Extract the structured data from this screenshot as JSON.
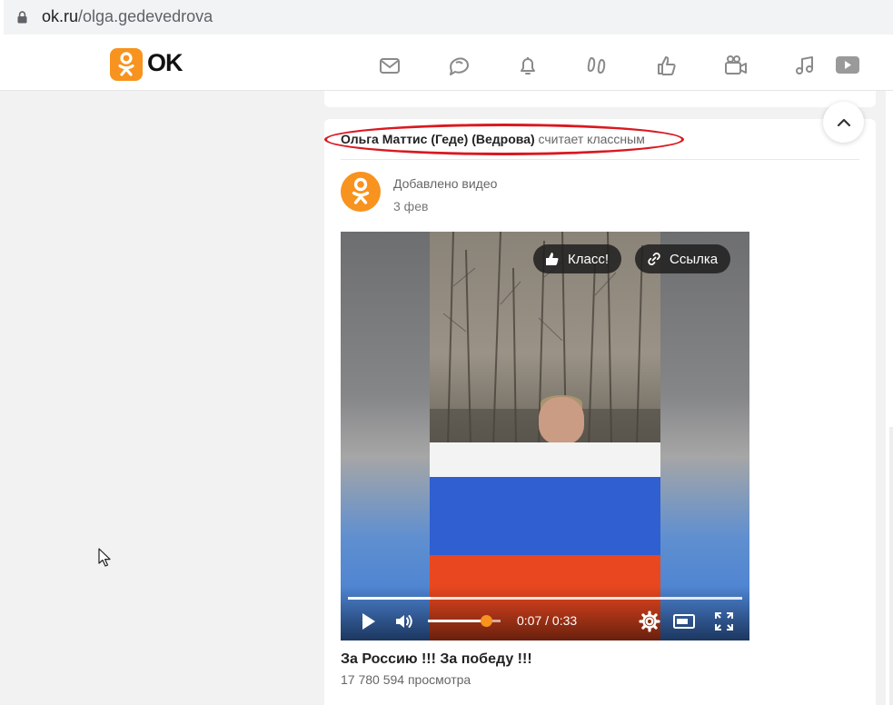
{
  "browser": {
    "url_host": "ok.ru",
    "url_path": "/olga.gedevedrova"
  },
  "header": {
    "logo_text": "OK",
    "nav_icons": [
      "mail-icon",
      "discussions-icon",
      "notifications-icon",
      "guests-icon",
      "likes-icon",
      "friends-icon",
      "music-icon",
      "video-icon"
    ]
  },
  "post": {
    "actor_name": "Ольга Маттис (Геде) (Ведрова)",
    "action_text": "считает классным",
    "type_label": "Добавлено видео",
    "date": "3 фев",
    "video": {
      "like_label": "Класс!",
      "link_label": "Ссылка",
      "time_display": "0:07 / 0:33",
      "progress_fraction": 0.21,
      "volume_fraction": 0.8
    },
    "title": "За Россию !!! За победу !!!",
    "views": "17 780 594 просмотра"
  },
  "colors": {
    "brand_orange": "#f7931e",
    "highlight_red": "#d9191f"
  }
}
